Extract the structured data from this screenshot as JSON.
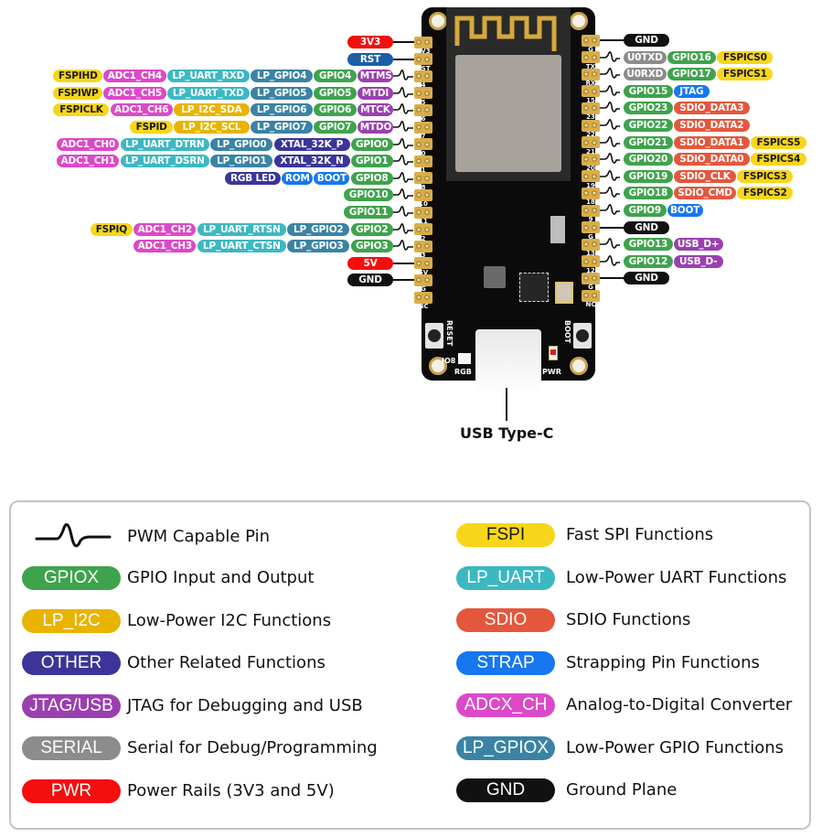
{
  "colors": {
    "GPIO": "#3fa34d",
    "LP_I2C": "#e8b400",
    "OTHER": "#3b3599",
    "JTAG_USB": "#9b3fb0",
    "SERIAL": "#8c8c8c",
    "PWR": "#f40e0e",
    "FSPI": "#f7d61a",
    "LP_UART": "#3cb8c2",
    "SDIO": "#e4573d",
    "STRAP": "#1677f0",
    "ADC": "#dc49c8",
    "LP_GPIO": "#3a83a4",
    "GND": "#111111",
    "RST": "#1a5ea8"
  },
  "board": {
    "left_silk": [
      "3V3",
      "RST",
      "4",
      "5",
      "6",
      "7",
      "0",
      "1",
      "8",
      "10",
      "11",
      "2",
      "3",
      "5V",
      "G",
      "NC"
    ],
    "right_silk": [
      "G",
      "TX",
      "RX",
      "15",
      "23",
      "22",
      "21",
      "20",
      "19",
      "18",
      "9",
      "G",
      "13",
      "12",
      "G",
      "NC"
    ],
    "labels": {
      "reset": "RESET",
      "boot": "BOOT",
      "io8": "IO8",
      "rgb": "RGB",
      "pwr": "PWR"
    },
    "connector_label": "USB Type-C"
  },
  "left_pins": [
    {
      "pwm": false,
      "labels": [
        {
          "text": "3V3",
          "type": "PWR"
        }
      ]
    },
    {
      "pwm": false,
      "labels": [
        {
          "text": "RST",
          "type": "RST"
        }
      ]
    },
    {
      "pwm": true,
      "labels": [
        {
          "text": "MTMS",
          "type": "JTAG_USB"
        },
        {
          "text": "GPIO4",
          "type": "GPIO"
        },
        {
          "text": "LP_GPIO4",
          "type": "LP_GPIO"
        },
        {
          "text": "LP_UART_RXD",
          "type": "LP_UART"
        },
        {
          "text": "ADC1_CH4",
          "type": "ADC"
        },
        {
          "text": "FSPIHD",
          "type": "FSPI"
        }
      ]
    },
    {
      "pwm": true,
      "labels": [
        {
          "text": "MTDI",
          "type": "JTAG_USB"
        },
        {
          "text": "GPIO5",
          "type": "GPIO"
        },
        {
          "text": "LP_GPIO5",
          "type": "LP_GPIO"
        },
        {
          "text": "LP_UART_TXD",
          "type": "LP_UART"
        },
        {
          "text": "ADC1_CH5",
          "type": "ADC"
        },
        {
          "text": "FSPIWP",
          "type": "FSPI"
        }
      ]
    },
    {
      "pwm": true,
      "labels": [
        {
          "text": "MTCK",
          "type": "JTAG_USB"
        },
        {
          "text": "GPIO6",
          "type": "GPIO"
        },
        {
          "text": "LP_GPIO6",
          "type": "LP_GPIO"
        },
        {
          "text": "LP_I2C_SDA",
          "type": "LP_I2C"
        },
        {
          "text": "ADC1_CH6",
          "type": "ADC"
        },
        {
          "text": "FSPICLK",
          "type": "FSPI"
        }
      ]
    },
    {
      "pwm": true,
      "labels": [
        {
          "text": "MTDO",
          "type": "JTAG_USB"
        },
        {
          "text": "GPIO7",
          "type": "GPIO"
        },
        {
          "text": "LP_GPIO7",
          "type": "LP_GPIO"
        },
        {
          "text": "LP_I2C_SCL",
          "type": "LP_I2C"
        },
        {
          "text": "FSPID",
          "type": "FSPI"
        }
      ]
    },
    {
      "pwm": true,
      "labels": [
        {
          "text": "GPIO0",
          "type": "GPIO"
        },
        {
          "text": "XTAL_32K_P",
          "type": "OTHER"
        },
        {
          "text": "LP_GPIO0",
          "type": "LP_GPIO"
        },
        {
          "text": "LP_UART_DTRN",
          "type": "LP_UART"
        },
        {
          "text": "ADC1_CH0",
          "type": "ADC"
        }
      ]
    },
    {
      "pwm": true,
      "labels": [
        {
          "text": "GPIO1",
          "type": "GPIO"
        },
        {
          "text": "XTAL_32K_N",
          "type": "OTHER"
        },
        {
          "text": "LP_GPIO1",
          "type": "LP_GPIO"
        },
        {
          "text": "LP_UART_DSRN",
          "type": "LP_UART"
        },
        {
          "text": "ADC1_CH1",
          "type": "ADC"
        }
      ]
    },
    {
      "pwm": true,
      "labels": [
        {
          "text": "GPIO8",
          "type": "GPIO"
        },
        {
          "text": "BOOT",
          "type": "STRAP"
        },
        {
          "text": "ROM",
          "type": "STRAP"
        },
        {
          "text": "RGB LED",
          "type": "OTHER"
        }
      ]
    },
    {
      "pwm": true,
      "labels": [
        {
          "text": "GPIO10",
          "type": "GPIO"
        }
      ]
    },
    {
      "pwm": true,
      "labels": [
        {
          "text": "GPIO11",
          "type": "GPIO"
        }
      ]
    },
    {
      "pwm": true,
      "labels": [
        {
          "text": "GPIO2",
          "type": "GPIO"
        },
        {
          "text": "LP_GPIO2",
          "type": "LP_GPIO"
        },
        {
          "text": "LP_UART_RTSN",
          "type": "LP_UART"
        },
        {
          "text": "ADC1_CH2",
          "type": "ADC"
        },
        {
          "text": "FSPIQ",
          "type": "FSPI"
        }
      ]
    },
    {
      "pwm": true,
      "labels": [
        {
          "text": "GPIO3",
          "type": "GPIO"
        },
        {
          "text": "LP_GPIO3",
          "type": "LP_GPIO"
        },
        {
          "text": "LP_UART_CTSN",
          "type": "LP_UART"
        },
        {
          "text": "ADC1_CH3",
          "type": "ADC"
        }
      ]
    },
    {
      "pwm": false,
      "labels": [
        {
          "text": "5V",
          "type": "PWR"
        }
      ]
    },
    {
      "pwm": false,
      "labels": [
        {
          "text": "GND",
          "type": "GND"
        }
      ]
    }
  ],
  "right_pins": [
    {
      "pwm": false,
      "labels": [
        {
          "text": "GND",
          "type": "GND"
        }
      ]
    },
    {
      "pwm": true,
      "labels": [
        {
          "text": "U0TXD",
          "type": "SERIAL"
        },
        {
          "text": "GPIO16",
          "type": "GPIO"
        },
        {
          "text": "FSPICS0",
          "type": "FSPI"
        }
      ]
    },
    {
      "pwm": true,
      "labels": [
        {
          "text": "U0RXD",
          "type": "SERIAL"
        },
        {
          "text": "GPIO17",
          "type": "GPIO"
        },
        {
          "text": "FSPICS1",
          "type": "FSPI"
        }
      ]
    },
    {
      "pwm": true,
      "labels": [
        {
          "text": "GPIO15",
          "type": "GPIO"
        },
        {
          "text": "JTAG",
          "type": "STRAP"
        }
      ]
    },
    {
      "pwm": true,
      "labels": [
        {
          "text": "GPIO23",
          "type": "GPIO"
        },
        {
          "text": "SDIO_DATA3",
          "type": "SDIO"
        }
      ]
    },
    {
      "pwm": true,
      "labels": [
        {
          "text": "GPIO22",
          "type": "GPIO"
        },
        {
          "text": "SDIO_DATA2",
          "type": "SDIO"
        }
      ]
    },
    {
      "pwm": true,
      "labels": [
        {
          "text": "GPIO21",
          "type": "GPIO"
        },
        {
          "text": "SDIO_DATA1",
          "type": "SDIO"
        },
        {
          "text": "FSPICS5",
          "type": "FSPI"
        }
      ]
    },
    {
      "pwm": true,
      "labels": [
        {
          "text": "GPIO20",
          "type": "GPIO"
        },
        {
          "text": "SDIO_DATA0",
          "type": "SDIO"
        },
        {
          "text": "FSPICS4",
          "type": "FSPI"
        }
      ]
    },
    {
      "pwm": true,
      "labels": [
        {
          "text": "GPIO19",
          "type": "GPIO"
        },
        {
          "text": "SDIO_CLK",
          "type": "SDIO"
        },
        {
          "text": "FSPICS3",
          "type": "FSPI"
        }
      ]
    },
    {
      "pwm": true,
      "labels": [
        {
          "text": "GPIO18",
          "type": "GPIO"
        },
        {
          "text": "SDIO_CMD",
          "type": "SDIO"
        },
        {
          "text": "FSPICS2",
          "type": "FSPI"
        }
      ]
    },
    {
      "pwm": true,
      "labels": [
        {
          "text": "GPIO9",
          "type": "GPIO"
        },
        {
          "text": "BOOT",
          "type": "STRAP"
        }
      ]
    },
    {
      "pwm": false,
      "labels": [
        {
          "text": "GND",
          "type": "GND"
        }
      ]
    },
    {
      "pwm": true,
      "labels": [
        {
          "text": "GPIO13",
          "type": "GPIO"
        },
        {
          "text": "USB_D+",
          "type": "JTAG_USB"
        }
      ]
    },
    {
      "pwm": true,
      "labels": [
        {
          "text": "GPIO12",
          "type": "GPIO"
        },
        {
          "text": "USB_D-",
          "type": "JTAG_USB"
        }
      ]
    },
    {
      "pwm": false,
      "labels": [
        {
          "text": "GND",
          "type": "GND"
        }
      ]
    }
  ],
  "legend": {
    "pwm": {
      "text": "PWM Capable Pin"
    },
    "left": [
      {
        "tag": "GPIOX",
        "type": "GPIO",
        "text": "GPIO Input and Output"
      },
      {
        "tag": "LP_I2C",
        "type": "LP_I2C",
        "text": "Low-Power I2C Functions"
      },
      {
        "tag": "OTHER",
        "type": "OTHER",
        "text": "Other Related Functions"
      },
      {
        "tag": "JTAG/USB",
        "type": "JTAG_USB",
        "text": "JTAG for Debugging and USB"
      },
      {
        "tag": "SERIAL",
        "type": "SERIAL",
        "text": "Serial for Debug/Programming"
      },
      {
        "tag": "PWR",
        "type": "PWR",
        "text": "Power Rails (3V3 and 5V)"
      }
    ],
    "right": [
      {
        "tag": "FSPI",
        "type": "FSPI",
        "text": "Fast SPI Functions"
      },
      {
        "tag": "LP_UART",
        "type": "LP_UART",
        "text": "Low-Power UART Functions"
      },
      {
        "tag": "SDIO",
        "type": "SDIO",
        "text": "SDIO Functions"
      },
      {
        "tag": "STRAP",
        "type": "STRAP",
        "text": "Strapping Pin Functions"
      },
      {
        "tag": "ADCX_CH",
        "type": "ADC",
        "text": "Analog-to-Digital Converter"
      },
      {
        "tag": "LP_GPIOX",
        "type": "LP_GPIO",
        "text": "Low-Power GPIO Functions"
      },
      {
        "tag": "GND",
        "type": "GND",
        "text": "Ground Plane"
      }
    ]
  }
}
